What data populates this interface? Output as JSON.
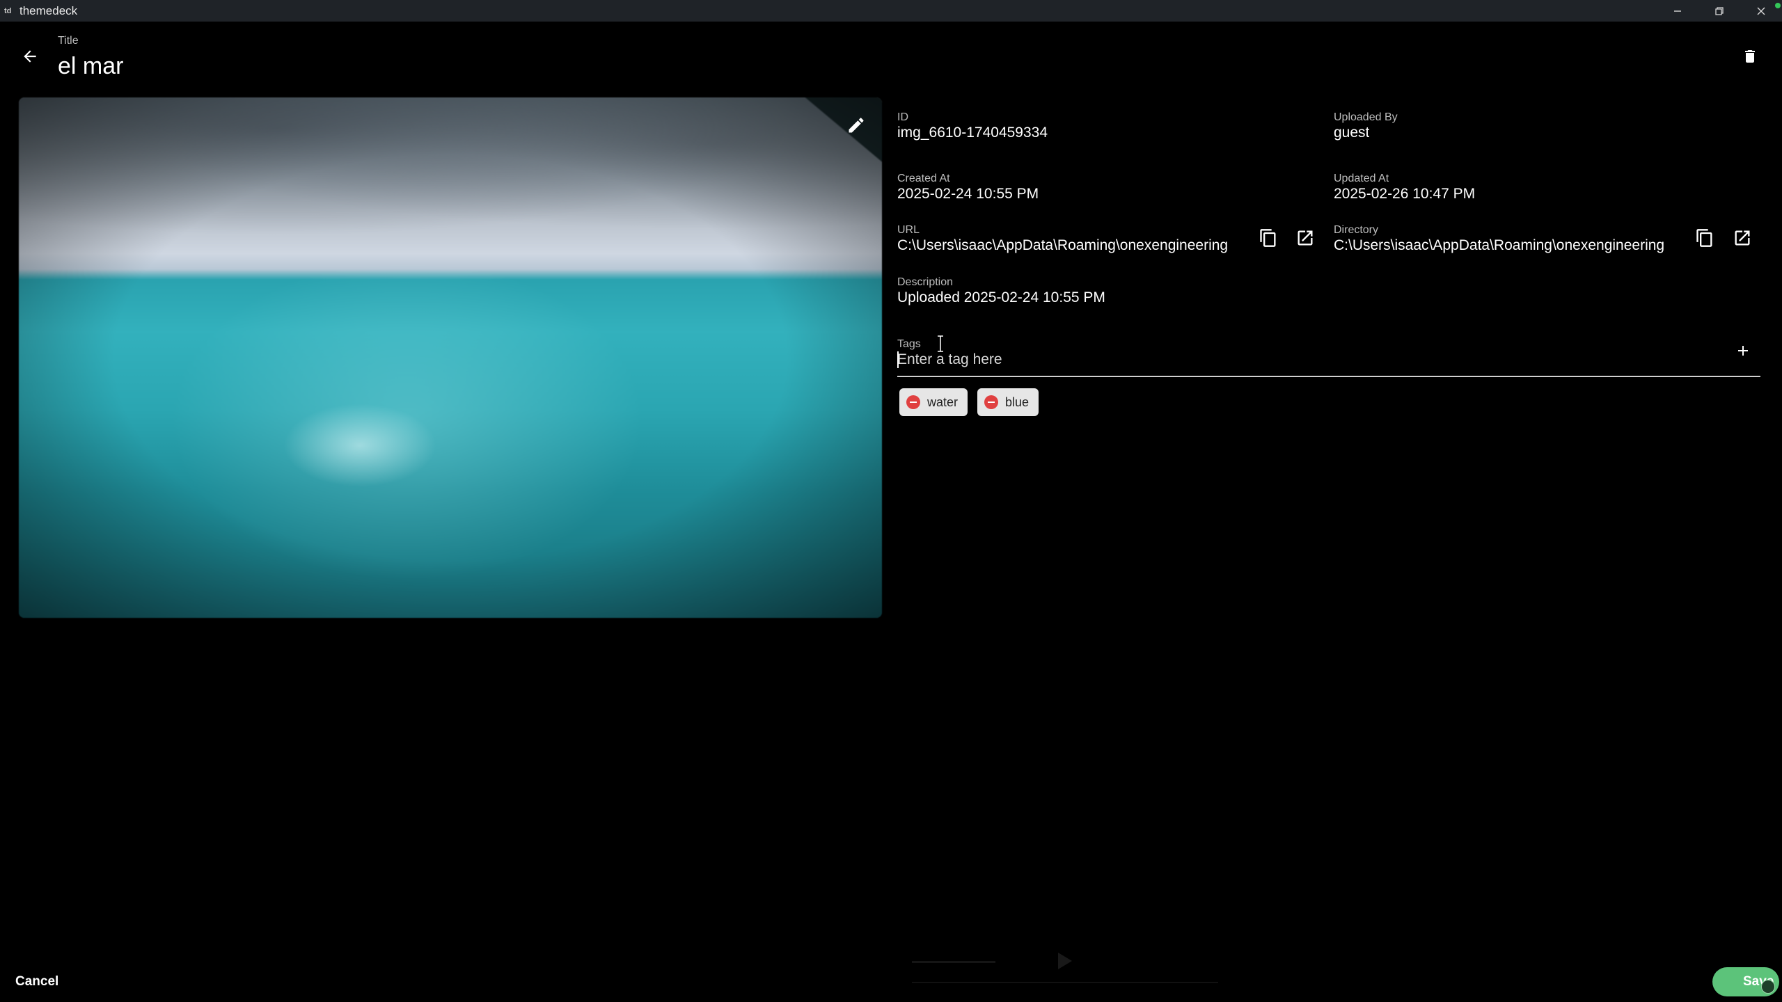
{
  "window": {
    "app_name": "themedeck",
    "app_icon_text": "td",
    "controls": [
      "minimize-icon",
      "restore-icon",
      "close-icon"
    ]
  },
  "header": {
    "title_label": "Title",
    "title_value": "el mar"
  },
  "details": {
    "id": {
      "label": "ID",
      "value": "img_6610-1740459334"
    },
    "uploaded_by": {
      "label": "Uploaded By",
      "value": "guest"
    },
    "created_at": {
      "label": "Created At",
      "value": "2025-02-24 10:55 PM"
    },
    "updated_at": {
      "label": "Updated At",
      "value": "2025-02-26 10:47 PM"
    },
    "url": {
      "label": "URL",
      "value": "C:\\Users\\isaac\\AppData\\Roaming\\onexengineering"
    },
    "directory": {
      "label": "Directory",
      "value": "C:\\Users\\isaac\\AppData\\Roaming\\onexengineering"
    },
    "description": {
      "label": "Description",
      "value": "Uploaded 2025-02-24 10:55 PM"
    }
  },
  "tags": {
    "label": "Tags",
    "placeholder": "Enter a tag here",
    "items": [
      "water",
      "blue"
    ]
  },
  "footer": {
    "cancel_label": "Cancel",
    "save_label": "Save"
  },
  "colors": {
    "background": "#000000",
    "titlebar": "#1f2328",
    "save_button": "#5cc37a",
    "chip_remove": "#e04040"
  }
}
